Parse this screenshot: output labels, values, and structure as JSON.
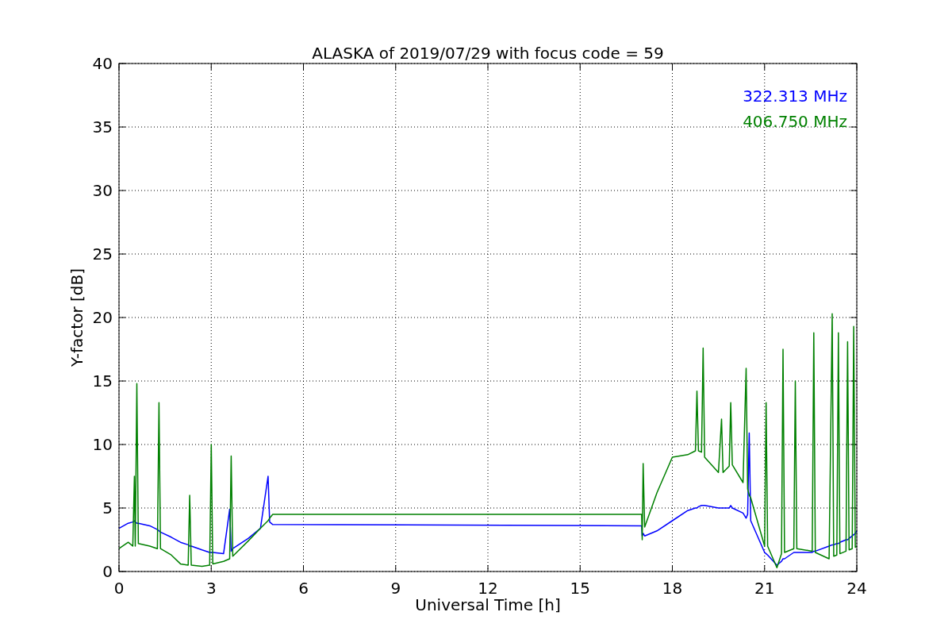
{
  "chart_data": {
    "type": "line",
    "title": "ALASKA of 2019/07/29 with focus code = 59",
    "xlabel": "Universal Time [h]",
    "ylabel": "Y-factor [dB]",
    "x": [
      0,
      0.3,
      0.45,
      0.5,
      0.53,
      0.58,
      0.63,
      1.0,
      1.25,
      1.3,
      1.35,
      1.7,
      2.0,
      2.25,
      2.3,
      2.35,
      2.7,
      2.95,
      3.0,
      3.05,
      3.4,
      3.6,
      3.65,
      3.7,
      4.2,
      4.6,
      4.85,
      4.9,
      5.0,
      17.0,
      17.02,
      17.05,
      17.1,
      17.5,
      18.0,
      18.5,
      18.75,
      18.8,
      18.85,
      18.95,
      19.0,
      19.05,
      19.5,
      19.6,
      19.65,
      19.85,
      19.9,
      19.95,
      20.3,
      20.4,
      20.45,
      20.5,
      20.55,
      21.0,
      21.05,
      21.1,
      21.4,
      21.55,
      21.6,
      21.65,
      21.95,
      22.0,
      22.05,
      22.55,
      22.6,
      22.65,
      23.1,
      23.2,
      23.25,
      23.35,
      23.4,
      23.45,
      23.65,
      23.7,
      23.75,
      23.85,
      23.9,
      23.95,
      24.0
    ],
    "series": [
      {
        "name": "322.313 MHz",
        "color": "#0000ff",
        "values": [
          3.4,
          3.8,
          3.9,
          4.0,
          3.9,
          3.8,
          3.8,
          3.6,
          3.3,
          3.2,
          3.1,
          2.7,
          2.3,
          2.1,
          2.0,
          2.0,
          1.7,
          1.5,
          1.5,
          1.5,
          1.4,
          4.9,
          1.6,
          1.8,
          2.6,
          3.4,
          7.5,
          3.9,
          3.7,
          3.6,
          2.8,
          3.0,
          2.8,
          3.2,
          4.0,
          4.8,
          5.0,
          5.0,
          5.1,
          5.2,
          5.2,
          5.2,
          5.0,
          5.0,
          5.0,
          5.0,
          5.2,
          5.0,
          4.6,
          4.2,
          4.5,
          10.9,
          4.0,
          1.5,
          1.4,
          1.3,
          0.5,
          0.8,
          1.0,
          1.0,
          1.5,
          1.5,
          1.5,
          1.5,
          1.6,
          1.6,
          2.0,
          2.1,
          2.1,
          2.2,
          2.2,
          2.3,
          2.5,
          2.5,
          2.6,
          2.8,
          2.9,
          3.0,
          3.2
        ]
      },
      {
        "name": "406.750 MHz",
        "color": "#008000",
        "values": [
          1.8,
          2.3,
          2.0,
          7.5,
          2.0,
          14.8,
          2.2,
          2.0,
          1.8,
          13.3,
          1.8,
          1.3,
          0.6,
          0.5,
          6.0,
          0.5,
          0.4,
          0.5,
          10.0,
          0.6,
          0.8,
          1.0,
          9.1,
          1.2,
          2.4,
          3.4,
          4.0,
          4.2,
          4.5,
          4.5,
          2.5,
          8.5,
          3.5,
          6.2,
          9.0,
          9.2,
          9.5,
          14.2,
          9.5,
          9.4,
          17.6,
          9.0,
          7.8,
          12.0,
          7.8,
          8.3,
          13.3,
          8.4,
          7.0,
          16.0,
          6.5,
          6.0,
          5.8,
          2.0,
          13.3,
          2.0,
          0.3,
          1.4,
          17.5,
          1.5,
          1.8,
          15.0,
          1.8,
          1.6,
          18.8,
          1.5,
          1.0,
          20.3,
          1.2,
          1.3,
          18.8,
          1.4,
          1.6,
          18.1,
          1.7,
          1.8,
          19.3,
          1.9,
          2.0
        ]
      }
    ],
    "xlim": [
      0,
      24
    ],
    "ylim": [
      0,
      40
    ],
    "xticks": [
      0,
      3,
      6,
      9,
      12,
      15,
      18,
      21,
      24
    ],
    "yticks": [
      0,
      5,
      10,
      15,
      20,
      25,
      30,
      35,
      40
    ],
    "grid": true
  }
}
